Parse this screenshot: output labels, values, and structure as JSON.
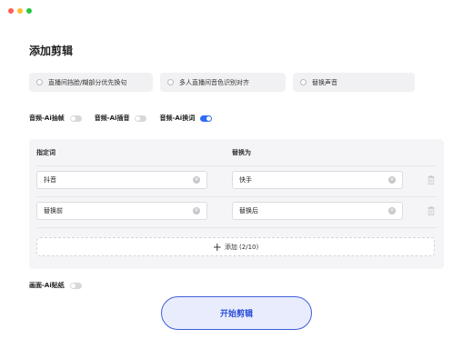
{
  "window": {
    "traffic_lights": [
      "#ff5f57",
      "#febc2e",
      "#28c840"
    ]
  },
  "page": {
    "title": "添加剪辑"
  },
  "options": [
    {
      "label": "直播间挡脸/糊部分优先换句",
      "checked": false
    },
    {
      "label": "多人直播间音色识别对齐",
      "checked": false
    },
    {
      "label": "替换声音",
      "checked": false
    }
  ],
  "audio_toggles": [
    {
      "label": "音频-Ai抽帧",
      "on": false
    },
    {
      "label": "音频-Ai插音",
      "on": false
    },
    {
      "label": "音频-Ai换词",
      "on": true
    }
  ],
  "replace_table": {
    "header_keyword": "指定词",
    "header_replacement": "替换为",
    "rows": [
      {
        "keyword": "抖音",
        "replacement": "快手"
      },
      {
        "keyword": "替换前",
        "replacement": "替换后"
      }
    ],
    "add_label": "添加 (2/10)"
  },
  "video_toggle": {
    "label": "画面-Ai贴纸",
    "on": false
  },
  "start_button": {
    "label": "开始剪辑"
  },
  "colors": {
    "accent": "#2f6cf5",
    "start_border": "#3f5fd9",
    "start_bg": "#e9ecfd"
  }
}
